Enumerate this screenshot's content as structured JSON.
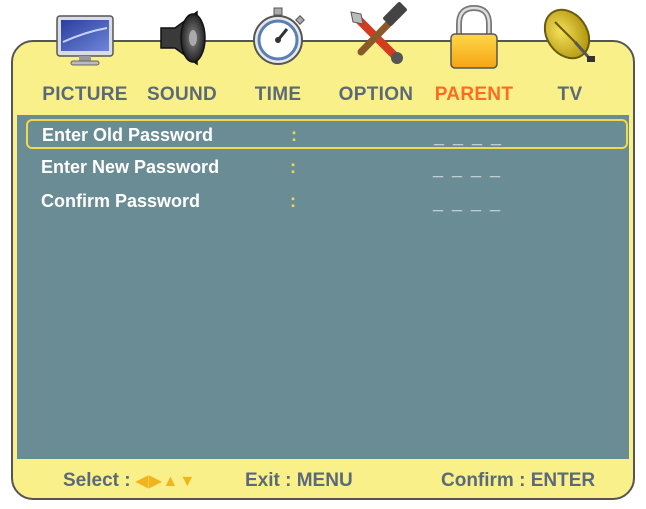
{
  "tabs": [
    {
      "label": "PICTURE",
      "icon": "monitor-icon",
      "active": false
    },
    {
      "label": "SOUND",
      "icon": "speaker-icon",
      "active": false
    },
    {
      "label": "TIME",
      "icon": "stopwatch-icon",
      "active": false
    },
    {
      "label": "OPTION",
      "icon": "tools-icon",
      "active": false
    },
    {
      "label": "PARENT",
      "icon": "padlock-icon",
      "active": true
    },
    {
      "label": "TV",
      "icon": "satellite-dish-icon",
      "active": false
    }
  ],
  "rows": [
    {
      "label": "Enter Old Password",
      "colon": ":",
      "value": "_ _ _ _",
      "selected": true
    },
    {
      "label": "Enter New Password",
      "colon": ":",
      "value": "_ _ _ _",
      "selected": false
    },
    {
      "label": "Confirm Password",
      "colon": ":",
      "value": "_ _ _ _",
      "selected": false
    }
  ],
  "footer": {
    "select_label": "Select :",
    "select_arrows": "◀▶▲▼",
    "exit": "Exit : MENU",
    "confirm": "Confirm : ENTER"
  },
  "colors": {
    "frame_bg": "#f9f08a",
    "panel_bg": "#6a8c95",
    "active_tab": "#ff6b22",
    "inactive_tab": "#5a6a78",
    "highlight": "#f2d84c"
  }
}
